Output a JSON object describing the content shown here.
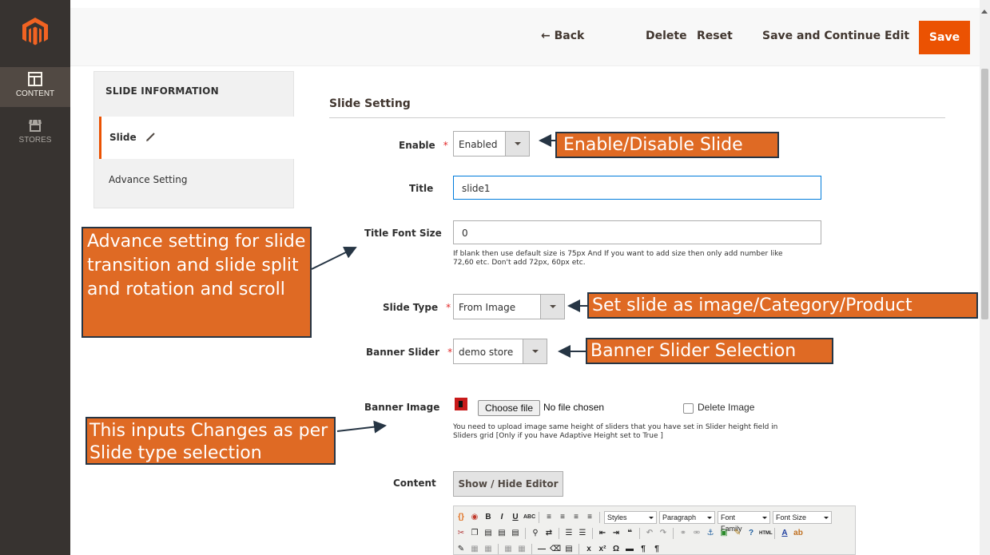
{
  "nav": {
    "items": [
      {
        "label": "CONTENT",
        "icon": "content-icon",
        "active": true
      },
      {
        "label": "STORES",
        "icon": "stores-icon",
        "active": false
      }
    ]
  },
  "actions": {
    "back": "Back",
    "delete": "Delete",
    "reset": "Reset",
    "save_continue": "Save and Continue Edit",
    "save": "Save"
  },
  "tabs": {
    "title": "SLIDE INFORMATION",
    "items": [
      {
        "label": "Slide",
        "active": true
      },
      {
        "label": "Advance Setting",
        "active": false
      }
    ]
  },
  "form": {
    "section_title": "Slide Setting",
    "enable": {
      "label": "Enable",
      "required": "*",
      "value": "Enabled"
    },
    "title": {
      "label": "Title",
      "value": "slide1"
    },
    "title_font_size": {
      "label": "Title Font Size",
      "value": "0",
      "note_line1": "If blank then use default size is 75px And If you want to add size then only add number like",
      "note_line2": "72,60 etc. Don't add 72px, 60px etc."
    },
    "slide_type": {
      "label": "Slide Type",
      "required": "*",
      "value": "From Image"
    },
    "banner_slider": {
      "label": "Banner Slider",
      "required": "*",
      "value": "demo store"
    },
    "banner_image": {
      "label": "Banner Image",
      "choose_file": "Choose file",
      "no_file": "No file chosen",
      "delete_label": "Delete Image",
      "note_line1": "You need to upload image same height of sliders that you have set in Slider height field in",
      "note_line2": "Sliders grid [Only if you have Adaptive Height set to True ]"
    },
    "content": {
      "label": "Content",
      "toggle_button": "Show / Hide Editor",
      "toolbar": {
        "styles": "Styles",
        "paragraph": "Paragraph",
        "font_family": "Font Family",
        "font_size": "Font Size"
      }
    }
  },
  "callouts": {
    "enable_disable": "Enable/Disable Slide",
    "slide_type": "Set slide as image/Category/Product",
    "banner_slider": "Banner Slider Selection",
    "advance_setting": "Advance setting for slide transition and slide split and rotation and scroll",
    "inputs_change": "This inputs Changes as per Slide type selection"
  },
  "colors": {
    "accent": "#eb5202",
    "nav_bg": "#373330",
    "callout_bg": "#df6a24",
    "callout_border": "#263544"
  }
}
